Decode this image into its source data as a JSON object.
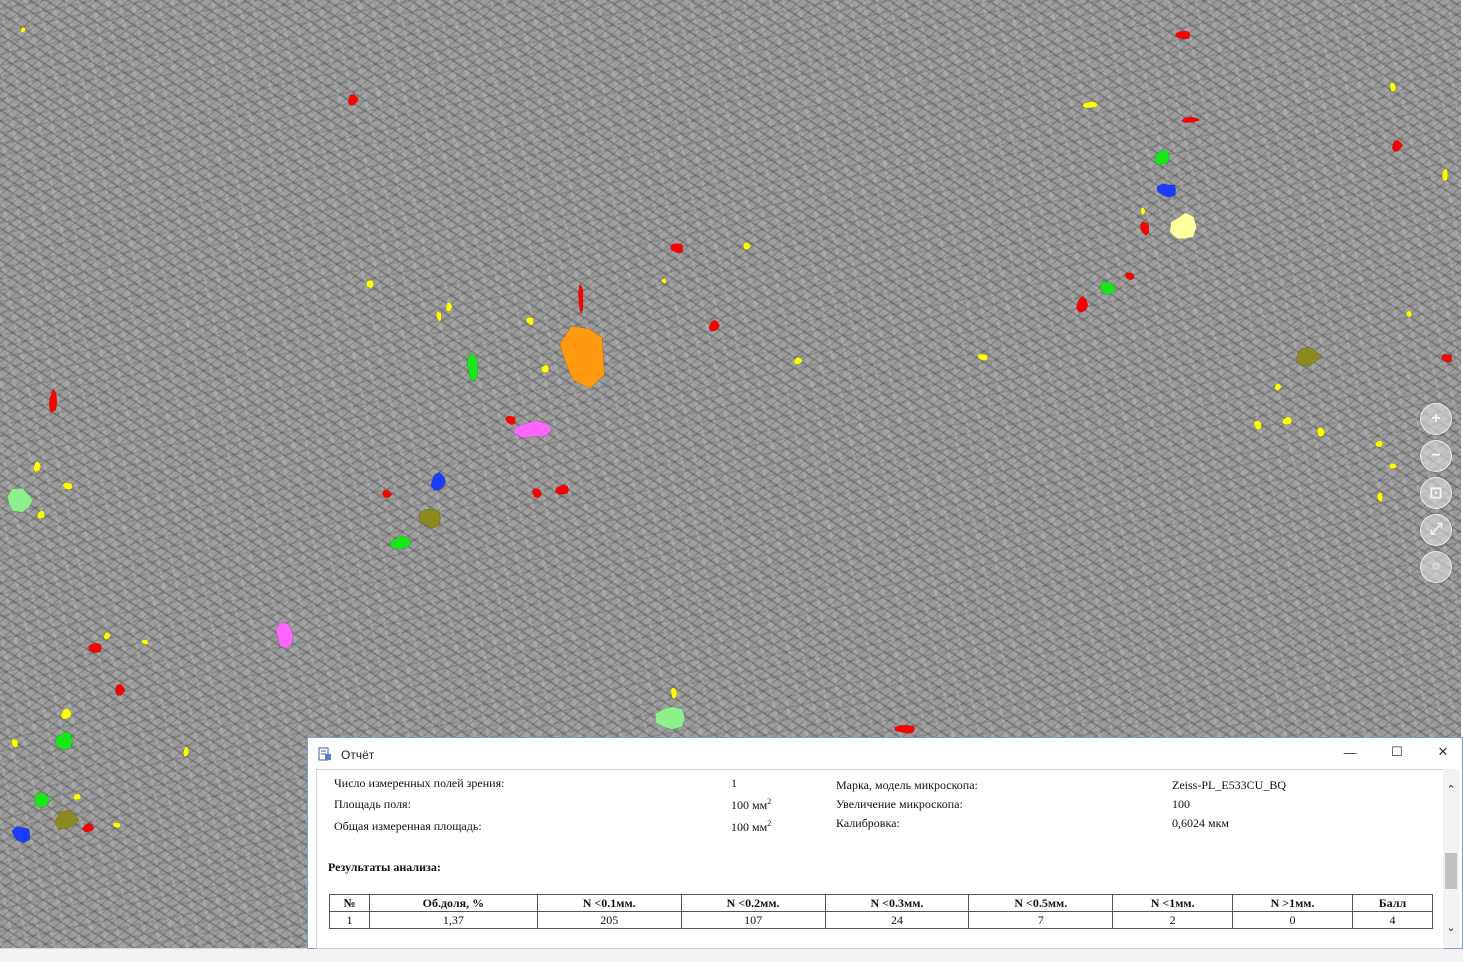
{
  "window": {
    "title": "Отчёт",
    "controls": {
      "minimize": "—",
      "maximize": "☐",
      "close": "✕"
    }
  },
  "info": {
    "fields_label": "Число измеренных полей зрения:",
    "fields_value": "1",
    "field_area_label": "Площадь поля:",
    "field_area_value": "100 мм",
    "field_area_sup": "2",
    "total_area_label": "Общая измеренная площадь:",
    "total_area_value": "100 мм",
    "total_area_sup": "2",
    "microscope_label": "Марка, модель микроскопа:",
    "microscope_value": "Zeiss-PL_E533CU_BQ",
    "magnification_label": "Увеличение микроскопа:",
    "magnification_value": "100",
    "calibration_label": "Калибровка:",
    "calibration_value": "0,6024 мкм"
  },
  "results": {
    "heading": "Результаты анализа:",
    "columns": [
      "№",
      "Об.доля, %",
      "N <0.1мм.",
      "N <0.2мм.",
      "N <0.3мм.",
      "N <0.5мм.",
      "N <1мм.",
      "N >1мм.",
      "Балл"
    ],
    "rows": [
      [
        "1",
        "1,37",
        "205",
        "107",
        "24",
        "7",
        "2",
        "0",
        "4"
      ]
    ]
  },
  "zoom_controls": [
    {
      "name": "zoom-in-icon",
      "glyph": "+"
    },
    {
      "name": "zoom-out-icon",
      "glyph": "−"
    },
    {
      "name": "zoom-fit-icon",
      "glyph": "⊡"
    },
    {
      "name": "zoom-full-icon",
      "glyph": "⤢"
    },
    {
      "name": "zoom-reset-icon",
      "glyph": "○"
    }
  ],
  "colors": {
    "inclusion_yellow": "#ffff00",
    "inclusion_red": "#ff0000",
    "inclusion_green": "#19e619",
    "inclusion_blue": "#1a3cff",
    "inclusion_orange": "#ff9a10",
    "inclusion_magenta": "#ff66ff",
    "inclusion_olive": "#8a8a1e",
    "inclusion_lightgreen": "#8cf08c",
    "inclusion_lightyellow": "#ffff9e"
  }
}
